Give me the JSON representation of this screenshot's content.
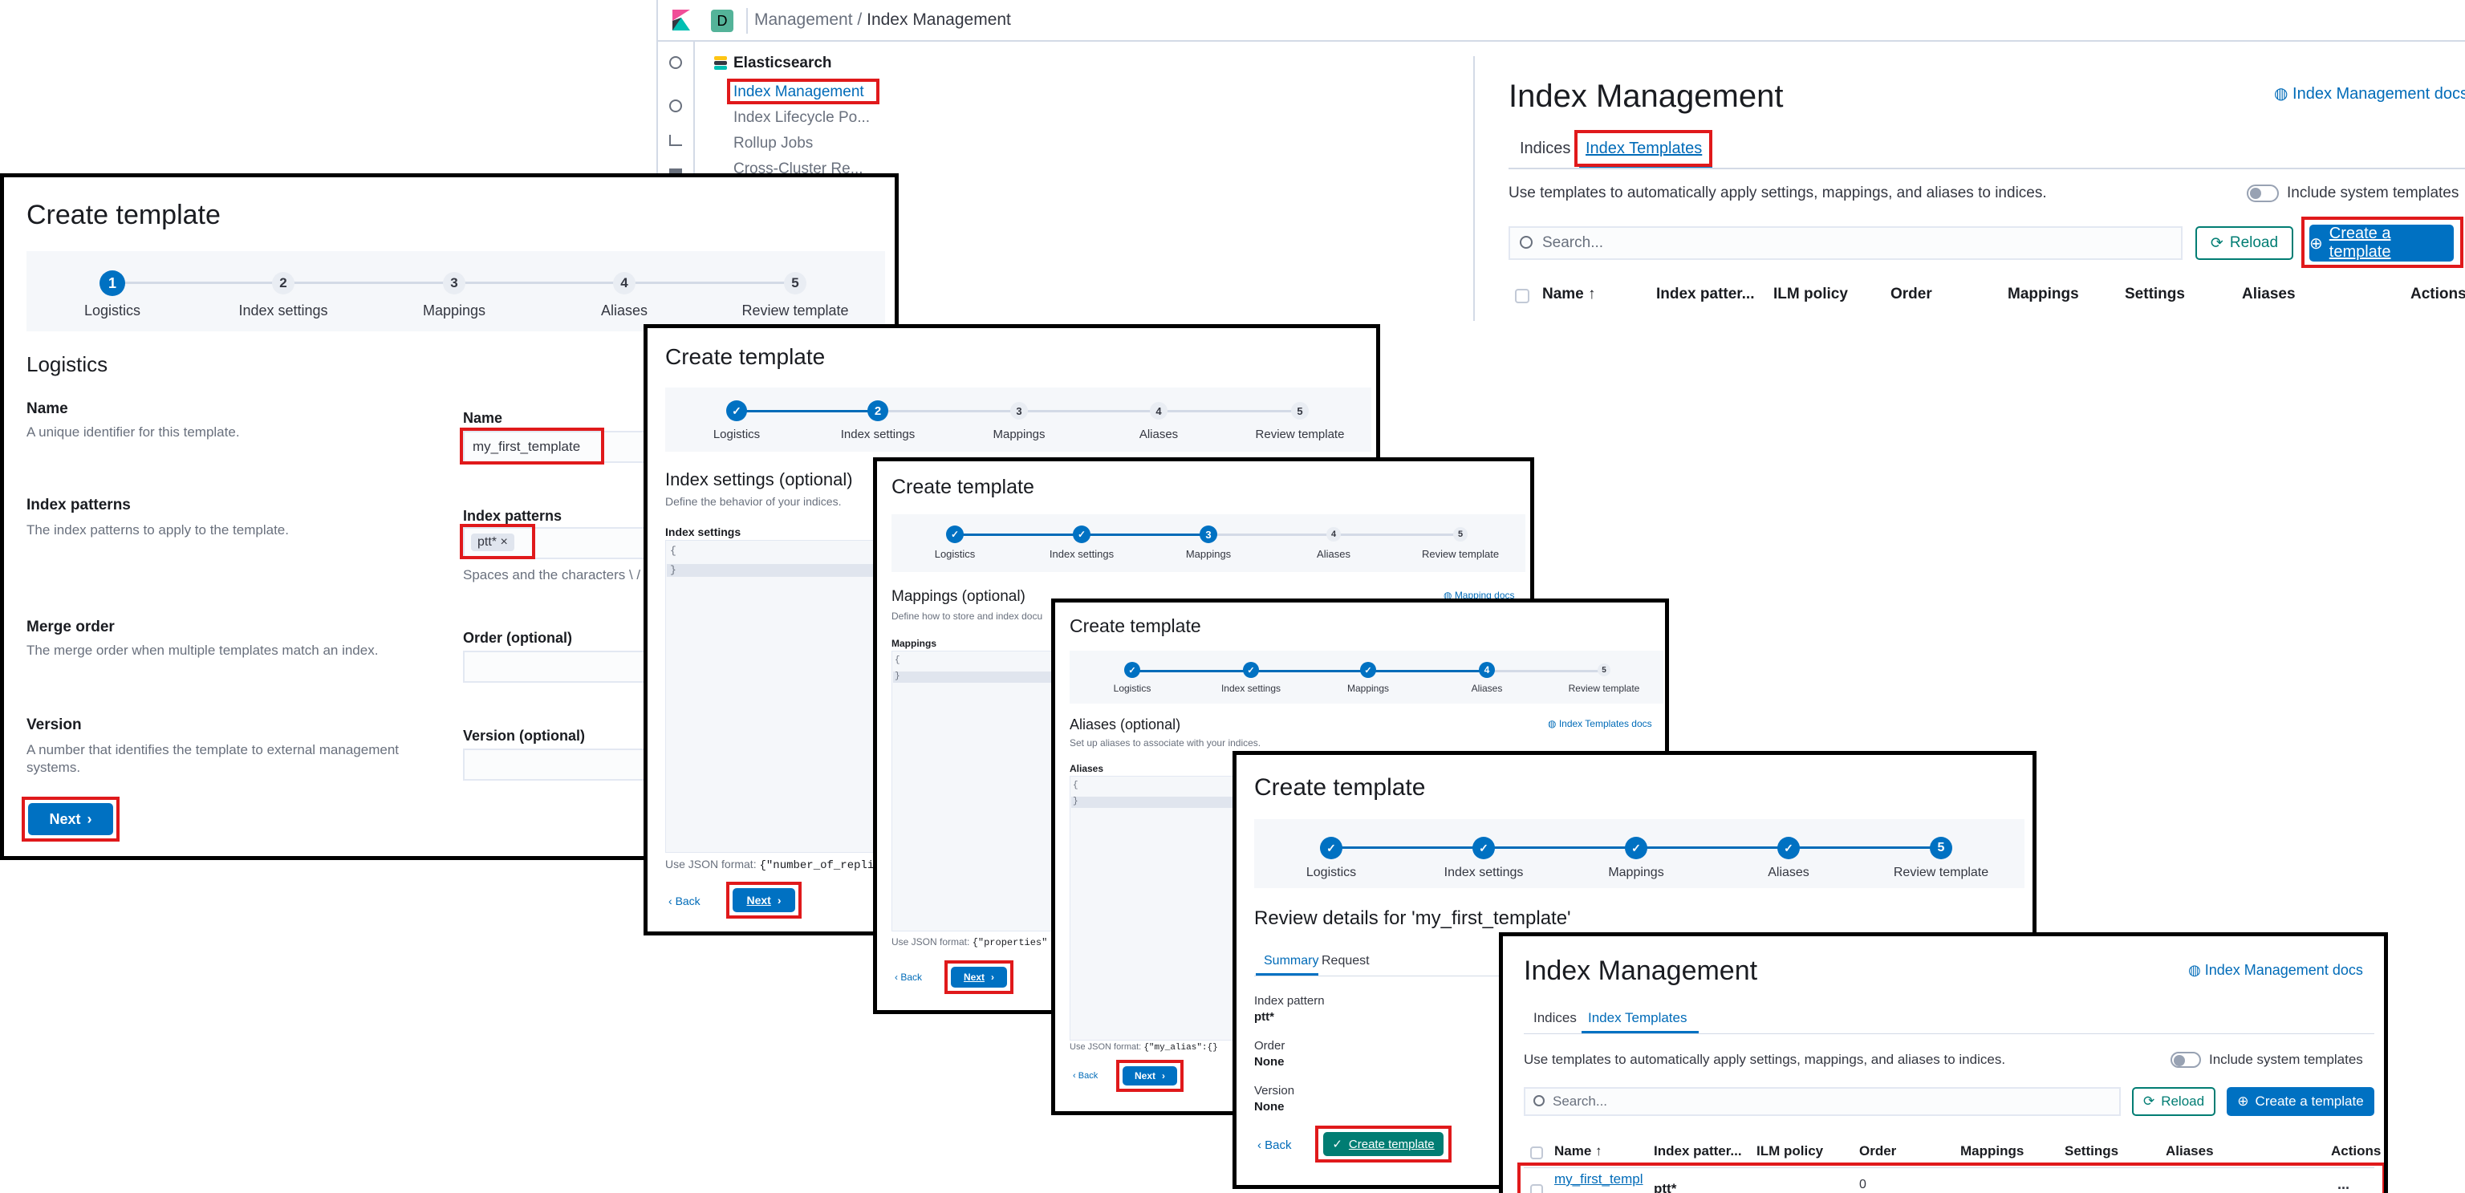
{
  "app": {
    "logo_letter": "D",
    "breadcrumb_root": "Management",
    "breadcrumb_sep": "/",
    "breadcrumb_current": "Index Management"
  },
  "sidebar": {
    "section": "Elasticsearch",
    "items": [
      "Index Management",
      "Index Lifecycle Po...",
      "Rollup Jobs",
      "Cross-Cluster Re..."
    ]
  },
  "im1": {
    "title": "Index Management",
    "docs": "Index Management docs",
    "tabs": [
      "Indices",
      "Index Templates"
    ],
    "desc": "Use templates to automatically apply settings, mappings, and aliases to indices.",
    "toggle_label": "Include system templates",
    "search_placeholder": "Search...",
    "reload": "Reload",
    "create": "Create a template",
    "cols": [
      "Name ↑",
      "Index patter...",
      "ILM policy",
      "Order",
      "Mappings",
      "Settings",
      "Aliases",
      "Actions"
    ]
  },
  "steps": [
    "Logistics",
    "Index settings",
    "Mappings",
    "Aliases",
    "Review template"
  ],
  "p1": {
    "title": "Create template",
    "section": "Logistics",
    "name_title": "Name",
    "name_desc": "A unique identifier for this template.",
    "name_label": "Name",
    "name_value": "my_first_template",
    "ip_title": "Index patterns",
    "ip_desc": "The index patterns to apply to the template.",
    "ip_label": "Index patterns",
    "ip_chip": "ptt*",
    "ip_help": "Spaces and the characters \\ /",
    "mo_title": "Merge order",
    "mo_desc": "The merge order when multiple templates match an index.",
    "mo_label": "Order (optional)",
    "v_title": "Version",
    "v_desc1": "A number that identifies the template to external management",
    "v_desc2": "systems.",
    "v_label": "Version (optional)",
    "next": "Next"
  },
  "p2": {
    "title": "Create template",
    "section": "Index settings (optional)",
    "desc": "Define the behavior of your indices.",
    "editor_label": "Index settings",
    "code_open": "{",
    "code_close": "}",
    "help": "Use JSON format:",
    "help_code": "{\"number_of_repli",
    "back": "Back",
    "next": "Next"
  },
  "p3": {
    "title": "Create template",
    "section": "Mappings (optional)",
    "desc": "Define how to store and index docu",
    "docs": "Mapping docs",
    "editor_label": "Mappings",
    "code_open": "{",
    "code_close": "}",
    "help": "Use JSON format:",
    "help_code": "{\"properties\"",
    "back": "Back",
    "next": "Next"
  },
  "p4": {
    "title": "Create template",
    "section": "Aliases (optional)",
    "desc": "Set up aliases to associate with your indices.",
    "docs": "Index Templates docs",
    "editor_label": "Aliases",
    "code_open": "{",
    "code_close": "}",
    "help": "Use JSON format:",
    "help_code": "{\"my_alias\":{}",
    "back": "Back",
    "next": "Next"
  },
  "p5": {
    "title": "Create template",
    "review": "Review details for 'my_first_template'",
    "tabs": [
      "Summary",
      "Request"
    ],
    "ip_label": "Index pattern",
    "ip_value": "ptt*",
    "order_label": "Order",
    "order_value": "None",
    "version_label": "Version",
    "version_value": "None",
    "back": "Back",
    "create": "Create template"
  },
  "p6": {
    "title": "Index Management",
    "docs": "Index Management docs",
    "tabs": [
      "Indices",
      "Index Templates"
    ],
    "desc": "Use templates to automatically apply settings, mappings, and aliases to indices.",
    "toggle_label": "Include system templates",
    "search_placeholder": "Search...",
    "reload": "Reload",
    "create": "Create a template",
    "cols": [
      "Name ↑",
      "Index patter...",
      "ILM policy",
      "Order",
      "Mappings",
      "Settings",
      "Aliases",
      "Actions"
    ],
    "row": {
      "name": "my_first_templ",
      "pattern": "ptt*",
      "order": "0",
      "actions": "..."
    }
  },
  "colors": {
    "primary": "#0071c2",
    "success": "#017d73",
    "highlight": "#e0191b"
  }
}
